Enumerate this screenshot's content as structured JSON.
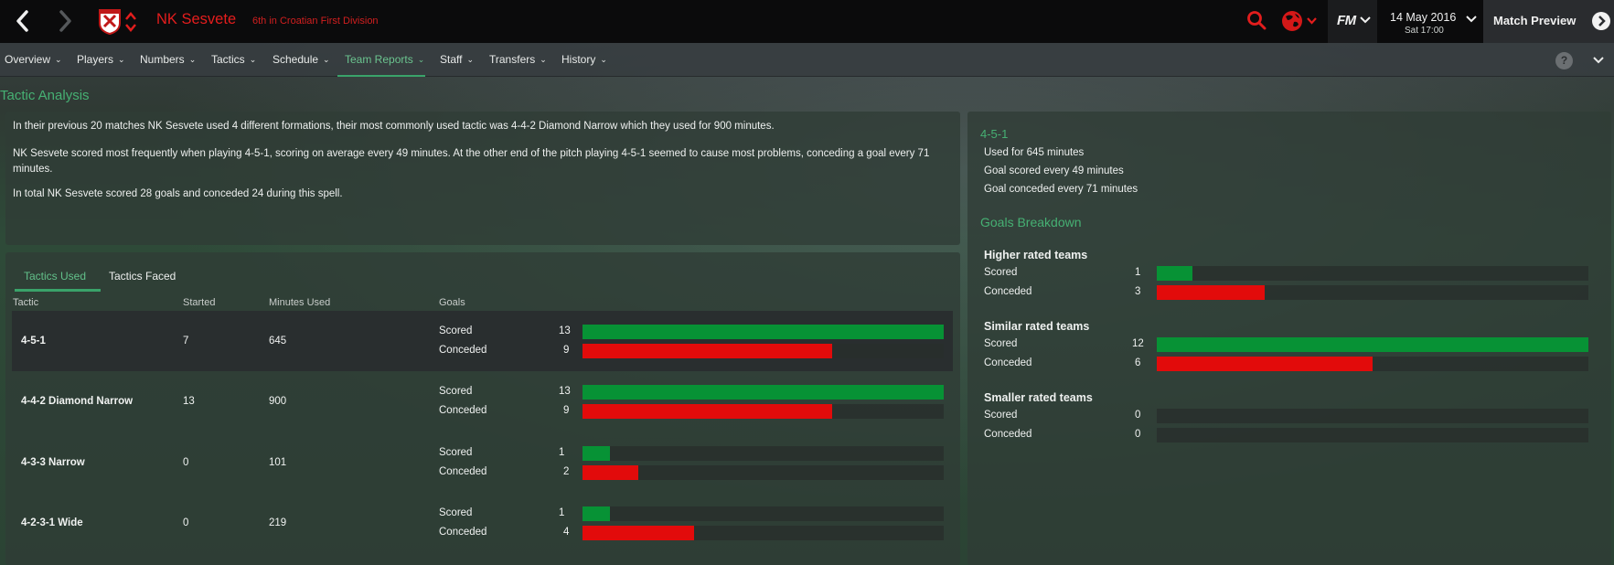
{
  "header": {
    "club_name": "NK Sesvete",
    "club_subtitle": "6th in Croatian First Division",
    "fm_logo": "FM",
    "date_main": "14 May 2016",
    "date_sub": "Sat 17:00",
    "continue_label": "Match Preview",
    "icons": [
      "back-arrow-icon",
      "forward-arrow-icon",
      "club-badge-icon",
      "search-icon",
      "globe-icon",
      "chevron-down-icon",
      "continue-arrow-icon"
    ],
    "colors": {
      "club_red": "#e41d1d",
      "accent_green": "#46b073"
    }
  },
  "menu": {
    "items": [
      "Overview",
      "Players",
      "Numbers",
      "Tactics",
      "Schedule",
      "Team Reports",
      "Staff",
      "Transfers",
      "History"
    ],
    "active": "Team Reports",
    "help": "?"
  },
  "analysis": {
    "title": "Tactic Analysis",
    "p1": "In their previous 20 matches NK Sesvete used 4 different formations, their most commonly used tactic was 4-4-2 Diamond Narrow which they used for 900 minutes.",
    "p2": "NK Sesvete scored most frequently when playing 4-5-1, scoring on average every 49 minutes. At the other end of the pitch playing 4-5-1 seemed to cause most problems, conceding a goal every 71 minutes.",
    "p3": "In total NK Sesvete scored 28 goals and conceded 24 during this spell."
  },
  "tactics": {
    "tabs": [
      "Tactics Used",
      "Tactics Faced"
    ],
    "active_tab": "Tactics Used",
    "headers": {
      "tactic": "Tactic",
      "started": "Started",
      "minutes": "Minutes Used",
      "goals": "Goals"
    },
    "scored_label": "Scored",
    "conceded_label": "Conceded",
    "bar_max": 13,
    "rows": [
      {
        "name": "4-5-1",
        "started": "7",
        "minutes": "645",
        "scored": 13,
        "conceded": 9
      },
      {
        "name": "4-4-2 Diamond Narrow",
        "started": "13",
        "minutes": "900",
        "scored": 13,
        "conceded": 9
      },
      {
        "name": "4-3-3 Narrow",
        "started": "0",
        "minutes": "101",
        "scored": 1,
        "conceded": 2
      },
      {
        "name": "4-2-3-1 Wide",
        "started": "0",
        "minutes": "219",
        "scored": 1,
        "conceded": 4
      }
    ]
  },
  "detail": {
    "title": "4-5-1",
    "used": "Used for 645 minutes",
    "scored_every": "Goal scored every 49 minutes",
    "conceded_every": "Goal conceded every 71 minutes",
    "breakdown_title": "Goals Breakdown",
    "bar_max": 12,
    "groups": [
      {
        "name": "Higher rated teams",
        "scored": 1,
        "conceded": 3
      },
      {
        "name": "Similar rated teams",
        "scored": 12,
        "conceded": 6
      },
      {
        "name": "Smaller rated teams",
        "scored": 0,
        "conceded": 0
      }
    ]
  }
}
